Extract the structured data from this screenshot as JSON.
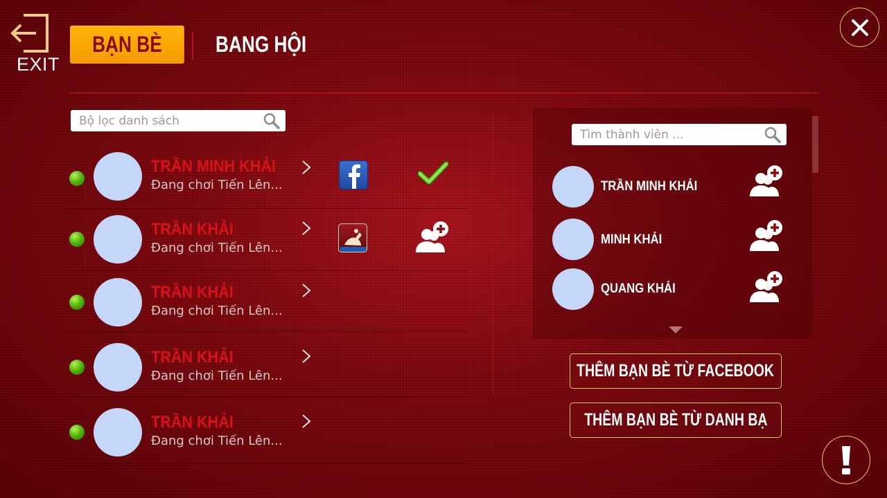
{
  "header": {
    "exit_label": "EXIT",
    "tab_active": "BẠN BÈ",
    "tab_inactive": "BANG HỘI"
  },
  "friends": {
    "search_placeholder": "Bộ lọc danh sách",
    "items": [
      {
        "name": "TRẦN MINH KHẢI",
        "status": "Đang chơi Tiến Lên...",
        "platform": "facebook",
        "action": "check"
      },
      {
        "name": "TRẦN  KHẢI",
        "status": "Đang chơi Tiến Lên...",
        "platform": "game",
        "action": "add-friend"
      },
      {
        "name": "TRẦN  KHẢI",
        "status": "Đang chơi Tiến Lên...",
        "platform": "",
        "action": ""
      },
      {
        "name": "TRẦN  KHẢI",
        "status": "Đang chơi Tiến Lên...",
        "platform": "",
        "action": ""
      },
      {
        "name": "TRẦN  KHẢI",
        "status": "Đang chơi Tiến Lên...",
        "platform": "",
        "action": ""
      }
    ]
  },
  "members": {
    "search_placeholder": "Tìm thành viên ...",
    "items": [
      {
        "name": "TRẦN MINH KHẢI"
      },
      {
        "name": "MINH KHẢI"
      },
      {
        "name": "QUANG KHẢI"
      }
    ]
  },
  "buttons": {
    "add_facebook": "THÊM BẠN BÈ TỪ FACEBOOK",
    "add_contacts": "THÊM BẠN BÈ TỪ DANH BẠ"
  },
  "colors": {
    "accent_gold": "#e8c37a",
    "tab_orange": "#ffb40a",
    "name_red": "#d8121a"
  }
}
